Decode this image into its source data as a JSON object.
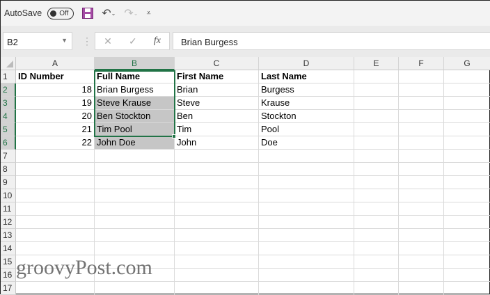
{
  "qat": {
    "autosave_label": "AutoSave",
    "toggle_state": "Off"
  },
  "formula_bar": {
    "name_box": "B2",
    "value": "Brian Burgess",
    "fx_label": "fx"
  },
  "columns": [
    "A",
    "B",
    "C",
    "D",
    "E",
    "F",
    "G"
  ],
  "rows": [
    "1",
    "2",
    "3",
    "4",
    "5",
    "6",
    "7",
    "8",
    "9",
    "10",
    "11",
    "12",
    "13",
    "14",
    "15",
    "16",
    "17"
  ],
  "cells": [
    [
      "ID Number",
      "Full Name",
      "First Name",
      "Last Name"
    ],
    [
      "18",
      "Brian Burgess",
      "Brian",
      "Burgess"
    ],
    [
      "19",
      "Steve Krause",
      "Steve",
      "Krause"
    ],
    [
      "20",
      "Ben Stockton",
      "Ben",
      "Stockton"
    ],
    [
      "21",
      "Tim Pool",
      "Tim",
      "Pool"
    ],
    [
      "22",
      "John Doe",
      "John",
      "Doe"
    ]
  ],
  "watermark": "groovyPost.com"
}
